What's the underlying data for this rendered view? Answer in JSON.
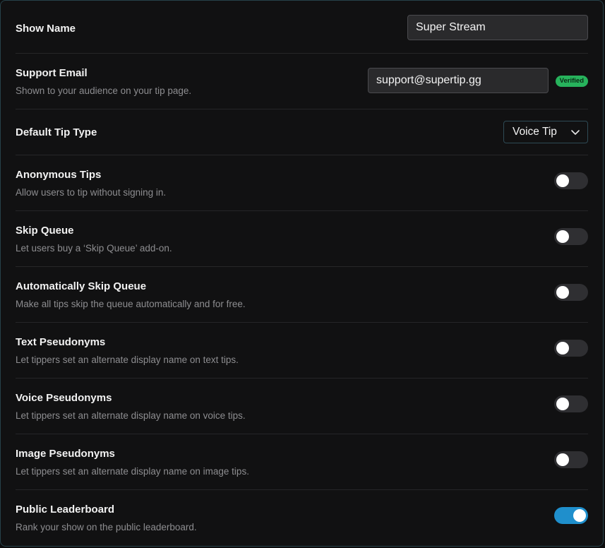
{
  "show_name": {
    "label": "Show Name",
    "value": "Super Stream"
  },
  "support_email": {
    "label": "Support Email",
    "description": "Shown to your audience on your tip page.",
    "value": "support@supertip.gg",
    "badge": "Verified",
    "badge_color": "#27b35c"
  },
  "default_tip_type": {
    "label": "Default Tip Type",
    "selected": "Voice Tip"
  },
  "settings": [
    {
      "label": "Anonymous Tips",
      "description": "Allow users to tip without signing in.",
      "enabled": false
    },
    {
      "label": "Skip Queue",
      "description": "Let users buy a ‘Skip Queue’ add-on.",
      "enabled": false
    },
    {
      "label": "Automatically Skip Queue",
      "description": "Make all tips skip the queue automatically and for free.",
      "enabled": false
    },
    {
      "label": "Text Pseudonyms",
      "description": "Let tippers set an alternate display name on text tips.",
      "enabled": false
    },
    {
      "label": "Voice Pseudonyms",
      "description": "Let tippers set an alternate display name on voice tips.",
      "enabled": false
    },
    {
      "label": "Image Pseudonyms",
      "description": "Let tippers set an alternate display name on image tips.",
      "enabled": false
    },
    {
      "label": "Public Leaderboard",
      "description": "Rank your show on the public leaderboard.",
      "enabled": true
    }
  ],
  "colors": {
    "background": "#111112",
    "toggle_on": "#1f8fcc",
    "toggle_off": "#2f2f32",
    "border": "#27424a"
  }
}
